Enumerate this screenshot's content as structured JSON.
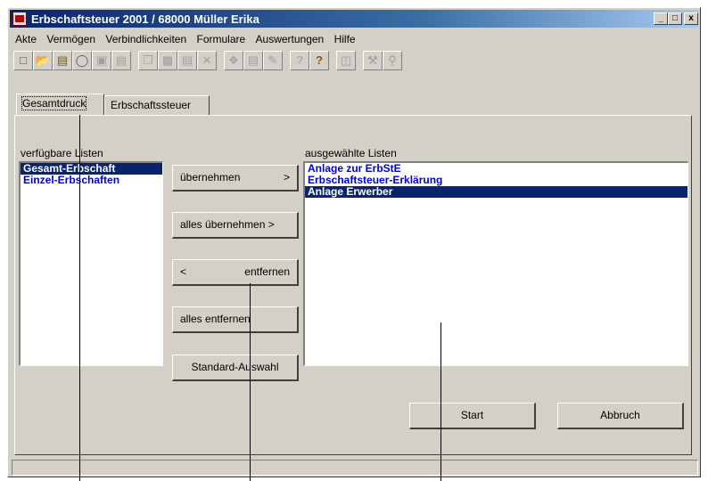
{
  "window": {
    "title": "Erbschaftsteuer 2001 / 68000 Müller Erika"
  },
  "title_buttons": {
    "minimize": "_",
    "maximize": "□",
    "close": "x"
  },
  "menu": [
    "Akte",
    "Vermögen",
    "Verbindlichkeiten",
    "Formulare",
    "Auswertungen",
    "Hilfe"
  ],
  "toolbar_icons": [
    "new-document-icon",
    "open-folder-icon",
    "folder-icon",
    "binoculars-icon",
    "save-icon",
    "print-icon",
    "copy-icon",
    "paste-icon",
    "edit-field-icon",
    "delete-icon",
    "stamp-icon",
    "book-icon",
    "form-icon",
    "context-help-icon",
    "help-icon",
    "window-icon",
    "tools-icon",
    "key-icon"
  ],
  "tabs": [
    "Gesamtdruck",
    "Erbschaftssteuer"
  ],
  "available": {
    "label": "verfügbare Listen",
    "items": [
      "Gesamt-Erbschaft",
      "Einzel-Erbschaften"
    ],
    "selected_index": 0
  },
  "selected": {
    "label": "ausgewählte Listen",
    "items": [
      "Anlage zur ErbStE",
      "Erbschaftsteuer-Erklärung",
      "Anlage Erwerber"
    ],
    "selected_index": 2
  },
  "buttons": {
    "take": {
      "text": "übernehmen",
      "arrow": ">"
    },
    "take_all": {
      "text": "alles übernehmen >"
    },
    "remove": {
      "arrow": "<",
      "text": "entfernen"
    },
    "remove_all": {
      "arrow": "<",
      "text": "alles entfernen"
    },
    "standard": "Standard-Auswahl",
    "start": "Start",
    "cancel": "Abbruch"
  }
}
